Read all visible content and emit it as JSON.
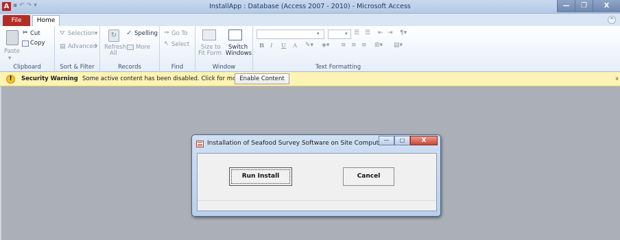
{
  "window": {
    "title": "InstallApp : Database (Access 2007 - 2010)  -  Microsoft Access",
    "app_icon": "A",
    "minimize": "—",
    "maximize": "❐",
    "close": "X"
  },
  "tabs": {
    "file": "File",
    "home": "Home"
  },
  "ribbon": {
    "clipboard": {
      "label": "Clipboard",
      "paste": "Paste",
      "cut": "Cut",
      "copy": "Copy"
    },
    "sort_filter": {
      "label": "Sort & Filter",
      "selection": "Selection",
      "advanced": "Advanced"
    },
    "records": {
      "label": "Records",
      "spelling": "Spelling",
      "refresh": "Refresh",
      "refresh_sub": "All",
      "more": "More"
    },
    "find": {
      "label": "Find",
      "goto": "Go To",
      "select": "Select"
    },
    "window": {
      "label": "Window",
      "size_to_fit": "Size to",
      "size_to_fit2": "Fit Form",
      "switch": "Switch",
      "switch2": "Windows"
    },
    "text_formatting": {
      "label": "Text Formatting",
      "bold": "B",
      "italic": "I",
      "underline": "U",
      "font_color": "A"
    }
  },
  "security": {
    "title": "Security Warning",
    "message": "Some active content has been disabled. Click for more details.",
    "enable_button": "Enable Content",
    "close": "x"
  },
  "dialog": {
    "title": "Installation of Seafood Survey Software on Site Computers",
    "run_button": "Run Install",
    "cancel_button": "Cancel",
    "min": "—",
    "max": "□",
    "close": "X"
  },
  "colors": {
    "file_tab": "#b32d25",
    "security_bar": "#fdf3b4",
    "workspace": "#abb0b8",
    "dialog_frame": "#b9d0ec"
  }
}
